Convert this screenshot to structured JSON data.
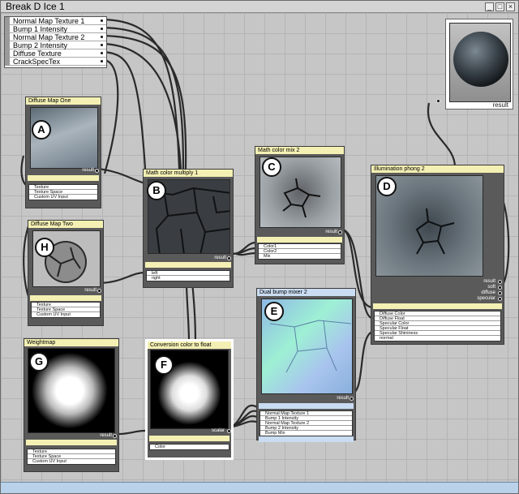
{
  "window": {
    "title": "Break D Ice 1",
    "controls": [
      "_",
      "□",
      "×"
    ]
  },
  "input_list": [
    "Normal Map Texture 1",
    "Bump 1 Intensity",
    "Normal Map Texture 2",
    "Bump 2 Intensity",
    "Diffuse Texture",
    "CrackSpecTex"
  ],
  "result": {
    "label": "result"
  },
  "nodes": {
    "A": {
      "badge": "A",
      "title": "Diffuse Map One",
      "out": "result",
      "inputs": [
        "Texture",
        "Texture Space",
        "Custom UV Input"
      ]
    },
    "B": {
      "badge": "B",
      "title": "Math color multiply 1",
      "out": "result",
      "inputs": [
        "left",
        "right"
      ]
    },
    "C": {
      "badge": "C",
      "title": "Math color mix 2",
      "out": "result",
      "inputs": [
        "Color1",
        "Color2",
        "Mix"
      ]
    },
    "D": {
      "badge": "D",
      "title": "Illumination phong 2",
      "outs": [
        "result",
        "soft",
        "diffuse",
        "specular"
      ],
      "inputs": [
        "Diffuse Color",
        "Diffuse Float",
        "Specular Color",
        "Specular Float",
        "Specular Shininess",
        "normal"
      ]
    },
    "E": {
      "badge": "E",
      "title": "Dual bump mixer 2",
      "out": "result",
      "inputs": [
        "Normal Map Texture 1",
        "Bump 1 Intensity",
        "Normal Map Texture 2",
        "Bump 2 Intensity",
        "Bump Mix"
      ]
    },
    "F": {
      "badge": "F",
      "title": "Conversion color to float",
      "out": "scalar",
      "inputs": [
        "Color"
      ]
    },
    "G": {
      "badge": "G",
      "title": "Weightmap",
      "out": "result",
      "inputs": [
        "Texture",
        "Texture Space",
        "Custom UV Input"
      ]
    },
    "H": {
      "badge": "H",
      "title": "Diffuse Map Two",
      "out": "result",
      "inputs": [
        "Texture",
        "Texture Space",
        "Custom UV Input"
      ]
    }
  },
  "colors": {
    "node_header": "#f4f0b4",
    "node_header_blue": "#c9dcf2",
    "node_body": "#5a5a5a",
    "wire": "#2a2a2a",
    "statusbar": "#b9d2ea"
  }
}
